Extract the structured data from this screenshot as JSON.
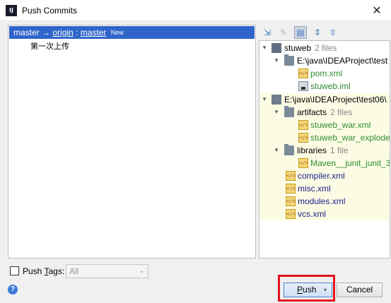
{
  "window": {
    "title": "Push Commits",
    "app_icon_text": "IJ",
    "close_glyph": "✕"
  },
  "commits": {
    "branch": {
      "local": "master",
      "arrow": "→",
      "remote": "origin",
      "separator": " : ",
      "remote_branch": "master",
      "badge": "New"
    },
    "message": "第一次上传"
  },
  "toolbar": {
    "icons": [
      "arrows-in-icon",
      "edit-icon",
      "group-icon",
      "expand-all-icon",
      "collapse-all-icon"
    ]
  },
  "files": {
    "module_name": "stuweb",
    "module_count": "2 files",
    "module_path": "E:\\java\\IDEAProject\\test",
    "pom": "pom.xml",
    "iml": "stuweb.iml",
    "project_path": "E:\\java\\IDEAProject\\test06\\",
    "artifacts": "artifacts",
    "artifacts_count": "2 files",
    "artifact_war": "stuweb_war.xml",
    "artifact_exploded": "stuweb_war_explode",
    "libraries": "libraries",
    "libraries_count": "1 file",
    "library_junit": "Maven__junit_junit_3_",
    "compiler": "compiler.xml",
    "misc": "misc.xml",
    "modules": "modules.xml",
    "vcs": "vcs.xml"
  },
  "tags": {
    "checkbox_checked": false,
    "label_prefix": "Push ",
    "label_mnemonic": "T",
    "label_suffix": "ags:",
    "select_value": "All"
  },
  "buttons": {
    "help": "?",
    "push_mnemonic": "P",
    "push_rest": "ush",
    "push_dropdown": "▾",
    "cancel": "Cancel"
  },
  "colors": {
    "selection": "#2f65ca",
    "highlight_box": "#e0141e",
    "new_file_green": "#2e8c2e",
    "changed_yellow_bg": "#fcfce4"
  }
}
